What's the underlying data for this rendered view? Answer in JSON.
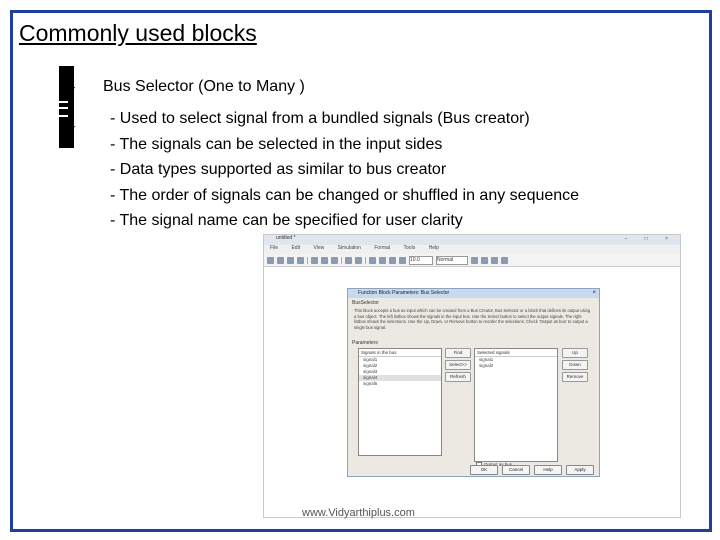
{
  "slide": {
    "title": "Commonly used blocks",
    "heading": "Bus Selector (One to Many )",
    "bullets": [
      "- Used to select signal from a bundled signals (Bus creator)",
      "- The signals can be selected in the input sides",
      "- Data types supported as similar to bus creator",
      "- The order of signals can be changed or shuffled in any sequence",
      "- The signal name can be specified for user clarity"
    ],
    "block_port_symbol": "▹",
    "frame_color": "#1f3fa0"
  },
  "screenshot": {
    "window_title": "untitled *",
    "window_controls": "– □ ×",
    "menu": [
      "File",
      "Edit",
      "View",
      "Simulation",
      "Format",
      "Tools",
      "Help"
    ],
    "sim_time": "10.0",
    "sim_mode": "Normal",
    "dialog": {
      "title": "Function Block Parameters: Bus Selector",
      "close_glyph": "×",
      "section": "BusSelector",
      "description": "This block accepts a bus as input which can be created from a Bus Creator, Bus Selector or a block that defines its output using a bus object. The left listbox shows the signals in the input bus. Use the Select button to select the output signals. The right listbox shows the selections. Use the Up, Down, or Remove button to reorder the selections. Check 'Output as bus' to output a single bus signal.",
      "parameters_label": "Parameters",
      "left_header": "Signals in the bus",
      "signals": [
        "signal1",
        "signal2",
        "signal3",
        "signal4",
        "signal5"
      ],
      "right_header": "Selected signals",
      "selected": [
        "signal1",
        "signal2"
      ],
      "buttons_mid": [
        "Find",
        "Select>>",
        "Refresh"
      ],
      "buttons_right": [
        "Up",
        "Down",
        "Remove"
      ],
      "output_as_bus": "Output as bus",
      "footer_buttons": [
        "OK",
        "Cancel",
        "Help",
        "Apply"
      ]
    }
  },
  "watermark": "www.Vidyarthiplus.com"
}
